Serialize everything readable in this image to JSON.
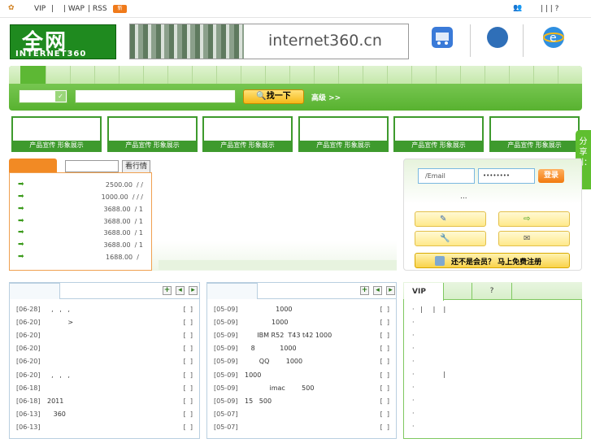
{
  "topbar": {
    "vip": "VIP",
    "sep1": "|",
    "wap": "| WAP",
    "rss": "| RSS",
    "new_badge": "新",
    "right_seps": "|    |    |    ?"
  },
  "header": {
    "logo_big": "全网",
    "logo_small": "INTERNET360",
    "banner_domain": "internet360.cn"
  },
  "search": {
    "button": "找一下",
    "advanced": "高级 >>"
  },
  "ads": [
    {
      "caption": "产品宣传  形象展示"
    },
    {
      "caption": "产品宣传  形象展示"
    },
    {
      "caption": "产品宣传  形象展示"
    },
    {
      "caption": "产品宣传  形象展示"
    },
    {
      "caption": "产品宣传  形象展示"
    },
    {
      "caption": "产品宣传  形象展示"
    }
  ],
  "share": "分享到：",
  "prices": {
    "rank_button": "看行情",
    "rows": [
      {
        "value": "2500.00  / /"
      },
      {
        "value": "1000.00  / / /"
      },
      {
        "value": "3688.00  / 1"
      },
      {
        "value": "3688.00  / 1"
      },
      {
        "value": "3688.00  / 1"
      },
      {
        "value": "3688.00  / 1"
      },
      {
        "value": "1688.00  /  "
      }
    ]
  },
  "login": {
    "email_placeholder": "/Email",
    "password_mask": "••••••••",
    "button": "登录",
    "dots": "...",
    "register": "还不是会员？  马上免费注册"
  },
  "news_left": [
    {
      "date": "[06-28]",
      "title": "  ,   ,   ,",
      "br": "[  ]"
    },
    {
      "date": "[06-20]",
      "title": "          >",
      "br": "[  ]"
    },
    {
      "date": "[06-20]",
      "title": "",
      "br": "[  ]"
    },
    {
      "date": "[06-20]",
      "title": "",
      "br": "[  ]"
    },
    {
      "date": "[06-20]",
      "title": "",
      "br": "[  ]"
    },
    {
      "date": "[06-20]",
      "title": "  ,   ,   ,",
      "br": "[  ]"
    },
    {
      "date": "[06-18]",
      "title": "",
      "br": "[  ]"
    },
    {
      "date": "[06-18]",
      "title": "2011",
      "br": "[  ]"
    },
    {
      "date": "[06-13]",
      "title": "   360",
      "br": "[  ]"
    },
    {
      "date": "[06-13]",
      "title": "",
      "br": "[  ]"
    }
  ],
  "news_mid": [
    {
      "date": "[05-09]",
      "title": "               1000",
      "br": "[  ]"
    },
    {
      "date": "[05-09]",
      "title": "             1000",
      "br": "[  ]"
    },
    {
      "date": "[05-09]",
      "title": "      IBM R52  T43 t42 1000",
      "br": "[  ]"
    },
    {
      "date": "[05-09]",
      "title": "   8            1000",
      "br": "[  ]"
    },
    {
      "date": "[05-09]",
      "title": "       QQ        1000",
      "br": "[  ]"
    },
    {
      "date": "[05-09]",
      "title": "1000",
      "br": "[  ]"
    },
    {
      "date": "[05-09]",
      "title": "            imac        500",
      "br": "[  ]"
    },
    {
      "date": "[05-09]",
      "title": "15   500",
      "br": "[  ]"
    },
    {
      "date": "[05-07]",
      "title": "",
      "br": "[  ]"
    },
    {
      "date": "[05-07]",
      "title": "",
      "br": "[  ]"
    }
  ],
  "vip": {
    "tab": "VIP",
    "tab2": "?",
    "rows": [
      "·   |     |    |",
      "·",
      "·",
      "·",
      "·",
      "·              |",
      "·",
      "·",
      "·",
      "·"
    ]
  }
}
